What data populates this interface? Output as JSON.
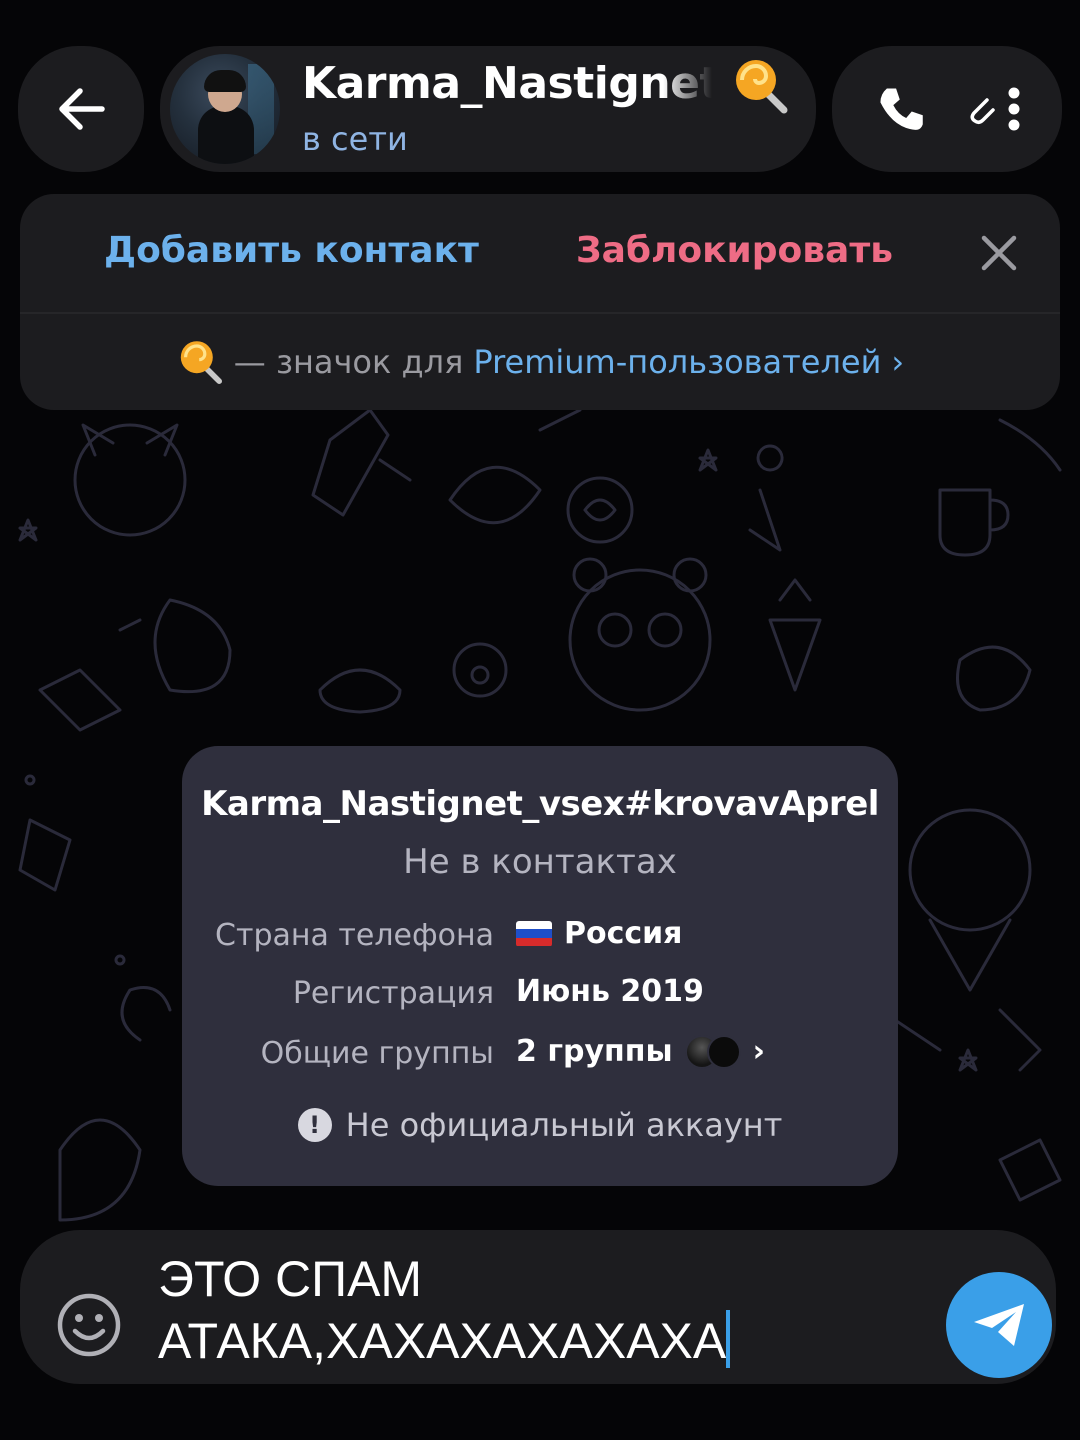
{
  "header": {
    "contact_name": "Karma_Nastignet_в",
    "status": "в сети",
    "premium_badge_icon": "lollipop-icon",
    "back_icon": "arrow-back-icon",
    "call_icon": "phone-icon",
    "menu_icon": "more-vertical-icon"
  },
  "action_bar": {
    "add_contact_label": "Добавить контакт",
    "block_label": "Заблокировать",
    "close_icon": "close-icon",
    "premium_text": "— значок для",
    "premium_link": "Premium-пользователей",
    "premium_chevron": "›"
  },
  "info_card": {
    "full_name": "Karma_Nastignet_vsex#krovavAprel",
    "subtitle": "Не в контактах",
    "rows": [
      {
        "label": "Страна телефона",
        "value": "Россия",
        "icon": "flag-ru-icon"
      },
      {
        "label": "Регистрация",
        "value": "Июнь 2019"
      },
      {
        "label": "Общие группы",
        "value": "2 группы",
        "chevron": "›"
      }
    ],
    "warning": "Не официальный аккаунт"
  },
  "input": {
    "line1": "ЭТО СПАМ",
    "line2": "АТАКА,ХАХАХАХАХАХА",
    "emoji_icon": "smile-icon",
    "send_icon": "send-icon"
  },
  "colors": {
    "accent_blue": "#6cb1ec",
    "danger_red": "#ee6c85",
    "send_blue": "#3a9fe8",
    "panel": "#1c1c1f",
    "card": "#2f2f3d"
  }
}
